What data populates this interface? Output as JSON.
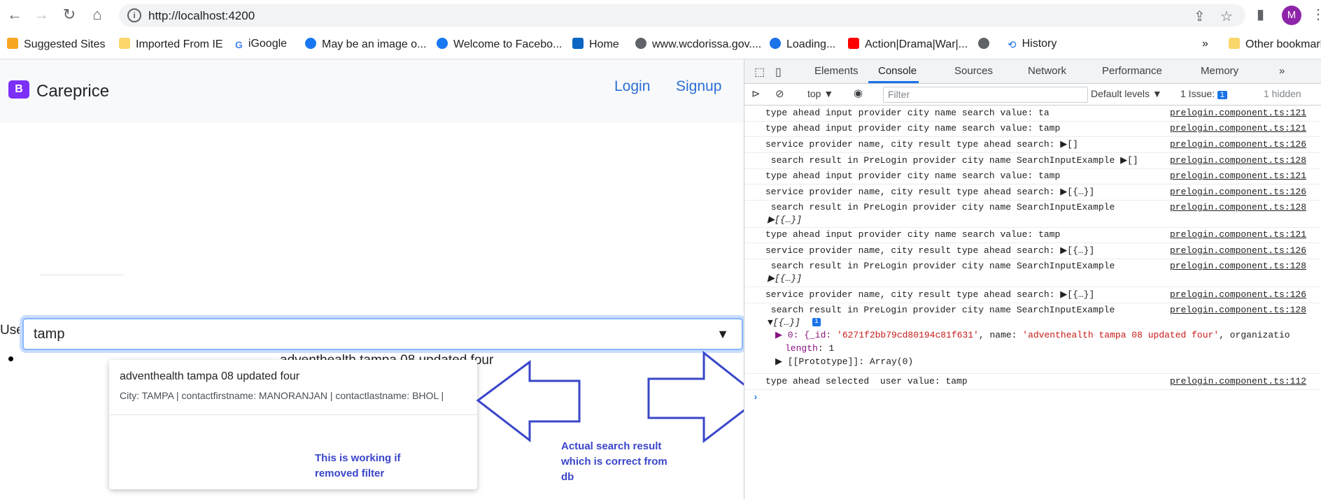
{
  "browser": {
    "url": "http://localhost:4200",
    "avatar_letter": "M",
    "bookmarks": [
      "Suggested Sites",
      "Imported From IE",
      "iGoogle",
      "May be an image o...",
      "Welcome to Facebo...",
      "Home",
      "www.wcdorissa.gov....",
      "Loading...",
      "Action|Drama|War|...",
      "History"
    ],
    "more": "»",
    "other": "Other bookmarks"
  },
  "app": {
    "brand": "Careprice",
    "logo_letter": "B",
    "login": "Login",
    "signup": "Signup",
    "user_label": "User",
    "search_value": "tamp",
    "behind_text": "adventhealth tampa 08 updated four",
    "dropdown_title": "adventhealth tampa 08 updated four",
    "dropdown_detail": "City: TAMPA | contactfirstname: MANORANJAN | contactlastname: BHOL |"
  },
  "annotations": {
    "left_note_1": "This is working if",
    "left_note_2": "removed filter",
    "right_note_1": "Actual search result",
    "right_note_2": "which is correct from",
    "right_note_3": "db"
  },
  "devtools": {
    "tabs": [
      "Elements",
      "Console",
      "Sources",
      "Network",
      "Performance",
      "Memory"
    ],
    "more_tabs": "»",
    "issues_count": "1",
    "context": "top ▼",
    "filter_placeholder": "Filter",
    "levels": "Default levels ▼",
    "issue_label": "1 Issue:",
    "hidden": "1 hidden",
    "logs": [
      {
        "msg": "type ahead input provider city name search value: ta",
        "src": "prelogin.component.ts:121"
      },
      {
        "msg": "type ahead input provider city name search value: tamp",
        "src": "prelogin.component.ts:121"
      },
      {
        "msg": "service provider name, city result type ahead search: ▶[]",
        "src": "prelogin.component.ts:126"
      },
      {
        "msg": " search result in PreLogin provider city name SearchInputExample ▶[]",
        "src": "prelogin.component.ts:128"
      },
      {
        "msg": "type ahead input provider city name search value: tamp",
        "src": "prelogin.component.ts:121"
      },
      {
        "msg": "service provider name, city result type ahead search: ▶[{…}]",
        "src": "prelogin.component.ts:126"
      },
      {
        "msg": " search result in PreLogin provider city name SearchInputExample",
        "msg2": "▶[{…}]",
        "src": "prelogin.component.ts:128"
      },
      {
        "msg": "type ahead input provider city name search value: tamp",
        "src": "prelogin.component.ts:121"
      },
      {
        "msg": "service provider name, city result type ahead search: ▶[{…}]",
        "src": "prelogin.component.ts:126"
      },
      {
        "msg": " search result in PreLogin provider city name SearchInputExample",
        "msg2": "▶[{…}]",
        "src": "prelogin.component.ts:128"
      },
      {
        "msg": "service provider name, city result type ahead search: ▶[{…}]",
        "src": "prelogin.component.ts:126"
      },
      {
        "msg": " search result in PreLogin provider city name SearchInputExample",
        "src": "prelogin.component.ts:128"
      }
    ],
    "expanded": {
      "head": "▼[{…}]",
      "item0_key": "▶ 0: {_id: ",
      "item0_id": "'6271f2bb79cd80194c81f631'",
      "item0_name_key": ", name: ",
      "item0_name": "'adventhealth tampa 08 updated four'",
      "item0_tail": ", organizatio",
      "length_key": "length",
      "length_val": ": 1",
      "proto": "▶ [[Prototype]]: Array(0)"
    },
    "last_log": {
      "msg": "type ahead selected  user value: tamp",
      "src": "prelogin.component.ts:112"
    },
    "prompt": "›"
  }
}
